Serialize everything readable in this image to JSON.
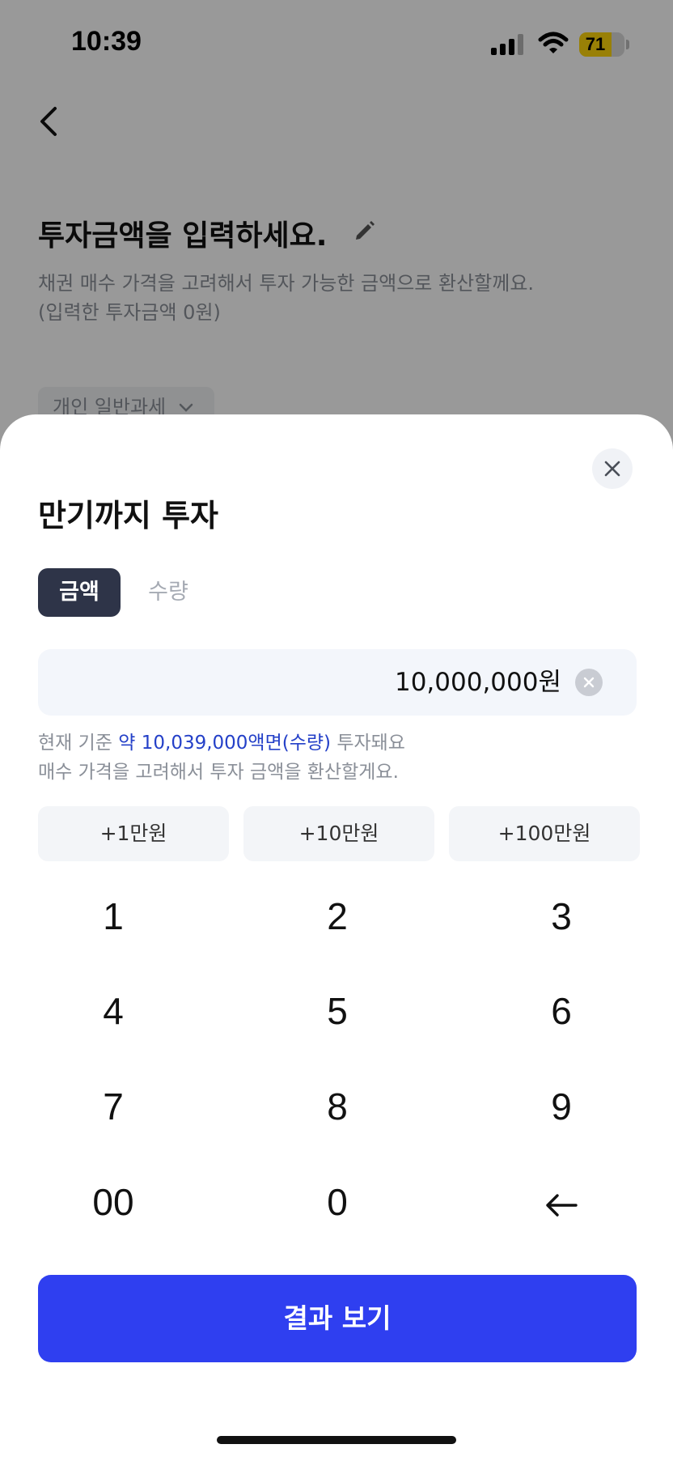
{
  "status_bar": {
    "time": "10:39",
    "battery": "71",
    "battery_level": 0.71
  },
  "background": {
    "title": "투자금액을 입력하세요.",
    "subtitle_line1": "채권 매수 가격을 고려해서 투자 가능한 금액으로 환산할께요.",
    "subtitle_line2": "(입력한 투자금액 0원)",
    "tax_chip": "개인 일반과세"
  },
  "sheet": {
    "title": "만기까지 투자",
    "tabs": [
      {
        "label": "금액",
        "active": true
      },
      {
        "label": "수량",
        "active": false
      }
    ],
    "amount_value": "10,000,000원",
    "info": {
      "prefix": "현재 기준 ",
      "highlight": "약 10,039,000액면(수량)",
      "suffix": " 투자돼요",
      "line2": "매수 가격을 고려해서 투자 금액을 환산할게요."
    },
    "quick_add": [
      "+1만원",
      "+10만원",
      "+100만원"
    ],
    "keypad": [
      "1",
      "2",
      "3",
      "4",
      "5",
      "6",
      "7",
      "8",
      "9",
      "00",
      "0"
    ],
    "keypad_backspace_icon": "backspace-arrow-icon",
    "result_button": "결과 보기"
  },
  "colors": {
    "primary_button": "#2f3ff0",
    "active_tab": "#2e3448",
    "info_highlight": "#2440c8",
    "battery": "#ffd60a"
  }
}
